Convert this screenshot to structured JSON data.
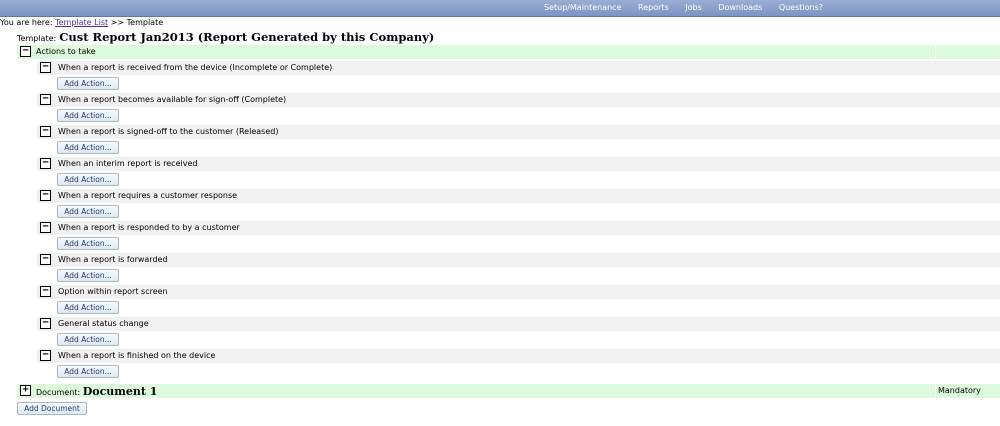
{
  "nav": {
    "items": [
      "Setup/Maintenance",
      "Reports",
      "Jobs",
      "Downloads",
      "Questions?"
    ]
  },
  "breadcrumb": {
    "prefix": "You are here:",
    "link": "Template List",
    "separator": ">>",
    "current": "Template"
  },
  "template": {
    "label": "Template:",
    "name": "Cust Report Jan2013 (Report Generated by this Company)"
  },
  "actions": {
    "header": "Actions to take",
    "toggle_symbol": "−",
    "add_action_label": "Add Action...",
    "triggers": [
      "When a report is received from the device (Incomplete or Complete)",
      "When a report becomes available for sign-off (Complete)",
      "When a report is signed-off to the customer (Released)",
      "When an interim report is received",
      "When a report requires a customer response",
      "When a report is responded to by a customer",
      "When a report is forwarded",
      "Option within report screen",
      "General status change",
      "When a report is finished on the device"
    ]
  },
  "document": {
    "label": "Document:",
    "name": "Document 1",
    "status": "Mandatory",
    "toggle_symbol": "+"
  },
  "add_document_label": "Add Document",
  "colors": {
    "nav_bar": "#7b94c4",
    "section_bar": "#dcfadc",
    "row_bg": "#f1f1f1",
    "link": "#4b2fa8"
  }
}
